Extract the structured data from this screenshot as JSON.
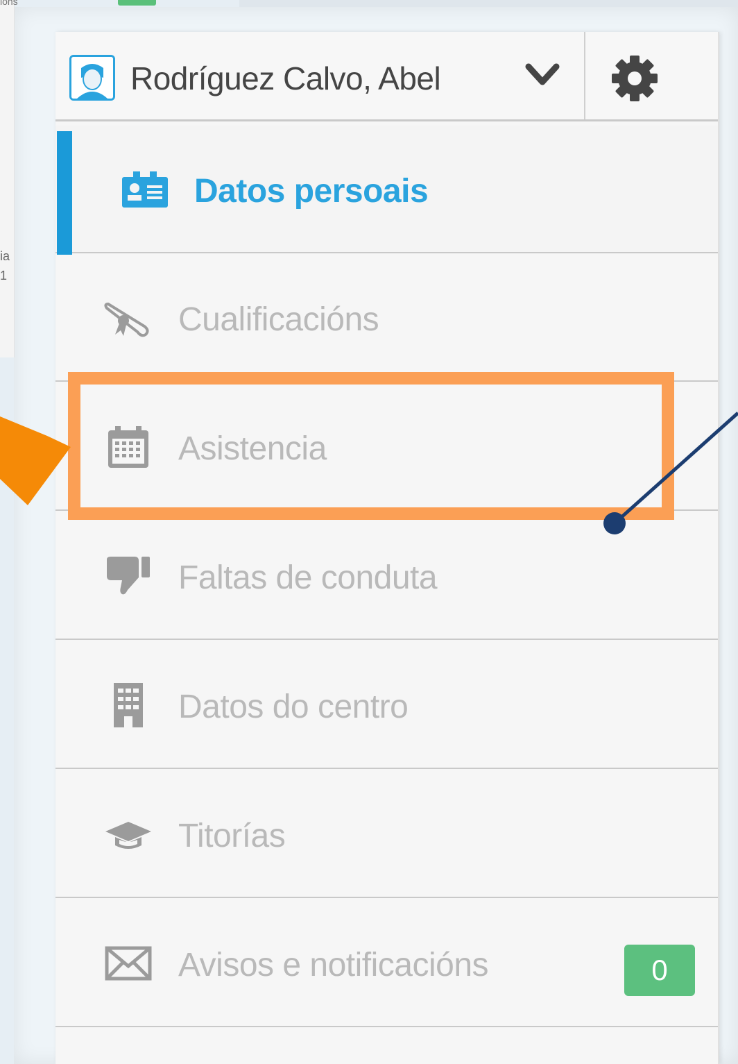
{
  "background": {
    "fragment_top": "ions",
    "fragment_line1": "ia",
    "fragment_line2": "1"
  },
  "header": {
    "user_name": "Rodríguez Calvo, Abel",
    "avatar_icon": "user-avatar-icon",
    "dropdown_icon": "chevron-down-icon",
    "settings_icon": "gear-icon"
  },
  "menu": {
    "items": [
      {
        "label": "Datos persoais",
        "icon": "id-card-icon",
        "active": true
      },
      {
        "label": "Cualificacións",
        "icon": "diploma-icon",
        "active": false
      },
      {
        "label": "Asistencia",
        "icon": "calendar-icon",
        "active": false,
        "highlighted": true
      },
      {
        "label": "Faltas de conduta",
        "icon": "thumbs-down-icon",
        "active": false
      },
      {
        "label": "Datos do centro",
        "icon": "building-icon",
        "active": false
      },
      {
        "label": "Titorías",
        "icon": "graduation-cap-icon",
        "active": false
      },
      {
        "label": "Avisos e notificacións",
        "icon": "envelope-icon",
        "active": false,
        "badge": "0"
      }
    ]
  },
  "colors": {
    "accent": "#2aa3de",
    "highlight": "#fb9f55",
    "arrow": "#f58a07",
    "badge": "#5cc07f",
    "connector": "#1c3d70"
  }
}
